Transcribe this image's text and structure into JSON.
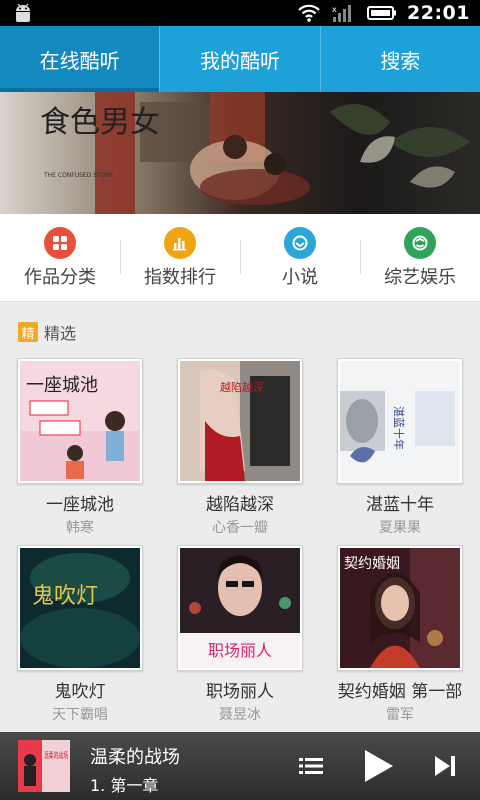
{
  "statusbar": {
    "time": "22:01"
  },
  "tabs": [
    {
      "label": "在线酷听"
    },
    {
      "label": "我的酷听"
    },
    {
      "label": "搜索"
    }
  ],
  "banner": {
    "title": "食色男女",
    "subtitle": "THE CONFUSED STORY"
  },
  "categories": [
    {
      "label": "作品分类",
      "icon": "grid-icon",
      "color": "#e8503a"
    },
    {
      "label": "指数排行",
      "icon": "bar-chart-icon",
      "color": "#f0a412"
    },
    {
      "label": "小说",
      "icon": "book-icon",
      "color": "#2ba6d9"
    },
    {
      "label": "综艺娱乐",
      "icon": "smile-icon",
      "color": "#2fa35a"
    }
  ],
  "section": {
    "badge": "精",
    "title": "精选"
  },
  "items": [
    {
      "name": "一座城池",
      "author": "韩寒",
      "cover_text": "一座城池"
    },
    {
      "name": "越陷越深",
      "author": "心香一瓣",
      "cover_text": "越陷越深"
    },
    {
      "name": "湛蓝十年",
      "author": "夏果果",
      "cover_text": "湛蓝十年"
    },
    {
      "name": "鬼吹灯",
      "author": "天下霸唱",
      "cover_text": "鬼吹灯"
    },
    {
      "name": "职场丽人",
      "author": "聂昱冰",
      "cover_text": "职场丽人"
    },
    {
      "name": "契约婚姻 第一部",
      "author": "雷军",
      "cover_text": "契约婚姻"
    }
  ],
  "player": {
    "title": "温柔的战场",
    "chapter": "1. 第一章",
    "thumb_text": "温柔的战场"
  }
}
